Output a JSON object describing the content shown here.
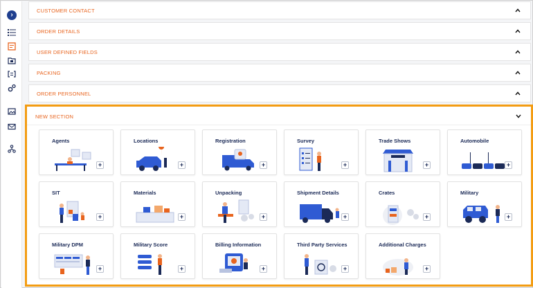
{
  "sections": [
    {
      "title": "CUSTOMER CONTACT"
    },
    {
      "title": "ORDER DETAILS"
    },
    {
      "title": "USER DEFINED FIELDS"
    },
    {
      "title": "PACKING"
    },
    {
      "title": "ORDER PERSONNEL"
    }
  ],
  "new_section": {
    "title": "NEW SECTION",
    "cards": [
      {
        "title": "Agents",
        "add": "+"
      },
      {
        "title": "Locations",
        "add": "+"
      },
      {
        "title": "Registration",
        "add": "+"
      },
      {
        "title": "Survey",
        "add": "+"
      },
      {
        "title": "Trade Shows",
        "add": "+"
      },
      {
        "title": "Automobile",
        "add": "+"
      },
      {
        "title": "SIT",
        "add": "+"
      },
      {
        "title": "Materials",
        "add": "+"
      },
      {
        "title": "Unpacking",
        "add": "+"
      },
      {
        "title": "Shipment Details",
        "add": "+"
      },
      {
        "title": "Crates",
        "add": "+"
      },
      {
        "title": "Military",
        "add": "+"
      },
      {
        "title": "Military DPM",
        "add": "+"
      },
      {
        "title": "Military Score",
        "add": "+"
      },
      {
        "title": "Billing Information",
        "add": "+"
      },
      {
        "title": "Third Party Services",
        "add": "+"
      },
      {
        "title": "Additional Charges",
        "add": "+"
      }
    ]
  },
  "sidebar": {
    "toggle": "›",
    "icons": [
      "list-icon",
      "document-icon",
      "folder-icon",
      "bracket-icon",
      "gears-icon",
      "image-icon",
      "mail-icon",
      "hierarchy-icon"
    ]
  },
  "colors": {
    "accent": "#e8641e",
    "highlight_border": "#f39c12",
    "navy": "#1b2a57",
    "primary_blue": "#2f5bd3"
  }
}
